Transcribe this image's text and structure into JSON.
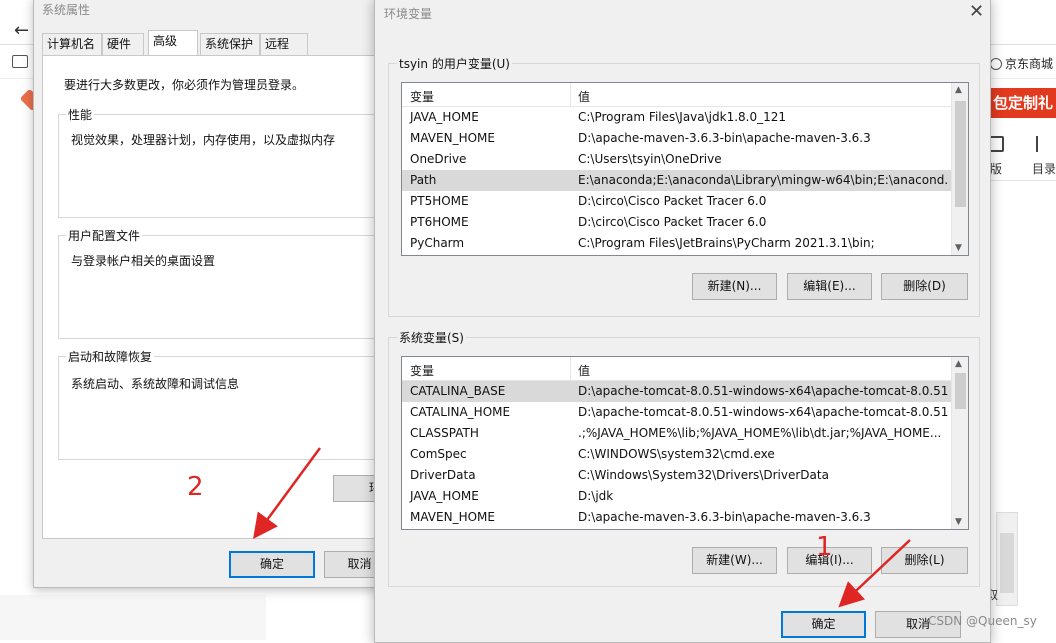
{
  "background": {
    "nav_back": "←",
    "bookmark_jd": "京东商城",
    "banner_text": "包定制礼",
    "icon_label_1": "版",
    "icon_label_2": "目录",
    "partial_text": "取"
  },
  "system_properties": {
    "title": "系统属性",
    "tabs": [
      "计算机名",
      "硬件",
      "高级",
      "系统保护",
      "远程"
    ],
    "active_tab": "高级",
    "intro": "要进行大多数更改，你必须作为管理员登录。",
    "groups": [
      {
        "label": "性能",
        "text": "视觉效果，处理器计划，内存使用，以及虚拟内存"
      },
      {
        "label": "用户配置文件",
        "text": "与登录帐户相关的桌面设置"
      },
      {
        "label": "启动和故障恢复",
        "text": "系统启动、系统故障和调试信息"
      }
    ],
    "hidden_button": "环",
    "ok_button": "确定",
    "cancel_button": "取消"
  },
  "env_dialog": {
    "title": "环境变量",
    "close_glyph": "✕",
    "user_vars": {
      "label": "tsyin 的用户变量(U)",
      "col_var": "变量",
      "col_val": "值",
      "rows": [
        {
          "name": "JAVA_HOME",
          "value": "C:\\Program Files\\Java\\jdk1.8.0_121"
        },
        {
          "name": "MAVEN_HOME",
          "value": "D:\\apache-maven-3.6.3-bin\\apache-maven-3.6.3"
        },
        {
          "name": "OneDrive",
          "value": "C:\\Users\\tsyin\\OneDrive"
        },
        {
          "name": "Path",
          "value": "E:\\anaconda;E:\\anaconda\\Library\\mingw-w64\\bin;E:\\anacond..."
        },
        {
          "name": "PT5HOME",
          "value": "D:\\circo\\Cisco Packet Tracer 6.0"
        },
        {
          "name": "PT6HOME",
          "value": "D:\\circo\\Cisco Packet Tracer 6.0"
        },
        {
          "name": "PyCharm",
          "value": "C:\\Program Files\\JetBrains\\PyCharm 2021.3.1\\bin;"
        }
      ],
      "selected_row": "Path",
      "new_button": "新建(N)...",
      "edit_button": "编辑(E)...",
      "delete_button": "删除(D)"
    },
    "system_vars": {
      "label": "系统变量(S)",
      "col_var": "变量",
      "col_val": "值",
      "rows": [
        {
          "name": "CATALINA_BASE",
          "value": "D:\\apache-tomcat-8.0.51-windows-x64\\apache-tomcat-8.0.51"
        },
        {
          "name": "CATALINA_HOME",
          "value": "D:\\apache-tomcat-8.0.51-windows-x64\\apache-tomcat-8.0.51"
        },
        {
          "name": "CLASSPATH",
          "value": ".;%JAVA_HOME%\\lib;%JAVA_HOME%\\lib\\dt.jar;%JAVA_HOME..."
        },
        {
          "name": "ComSpec",
          "value": "C:\\WINDOWS\\system32\\cmd.exe"
        },
        {
          "name": "DriverData",
          "value": "C:\\Windows\\System32\\Drivers\\DriverData"
        },
        {
          "name": "JAVA_HOME",
          "value": "D:\\jdk"
        },
        {
          "name": "MAVEN_HOME",
          "value": "D:\\apache-maven-3.6.3-bin\\apache-maven-3.6.3"
        }
      ],
      "selected_row": "CATALINA_BASE",
      "new_button": "新建(W)...",
      "edit_button": "编辑(I)...",
      "delete_button": "删除(L)"
    },
    "ok_button": "确定",
    "cancel_button": "取消"
  },
  "annotations": {
    "step1": "1",
    "step2": "2",
    "arrow_color": "#e02525"
  },
  "watermark": "CSDN @Queen_sy"
}
